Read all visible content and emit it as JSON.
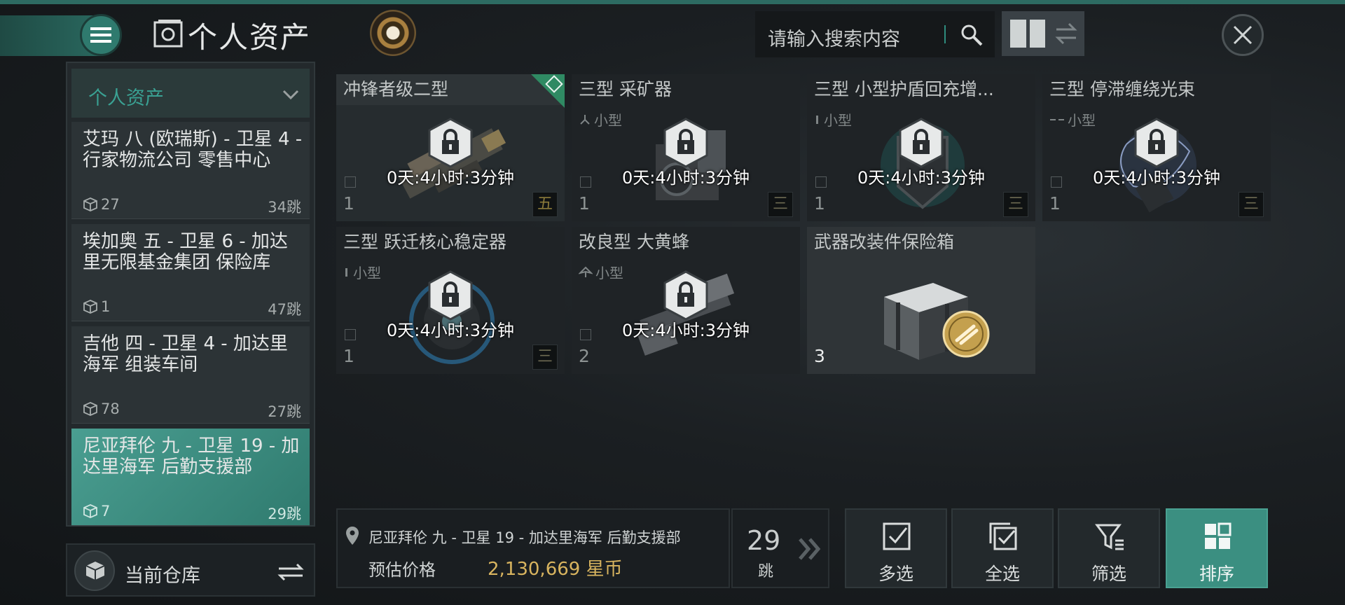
{
  "header": {
    "title": "个人资产",
    "search_placeholder": "请输入搜索内容"
  },
  "sidebar": {
    "dropdown_label": "个人资产",
    "locations": [
      {
        "name": "艾玛 八 (欧瑞斯) - 卫星 4 - 行家物流公司 零售中心",
        "count": "27",
        "jumps": "34跳"
      },
      {
        "name": "埃加奥 五 - 卫星 6 - 加达里无限基金集团 保险库",
        "count": "1",
        "jumps": "47跳"
      },
      {
        "name": "吉他 四 - 卫星 4 - 加达里海军 组装车间",
        "count": "78",
        "jumps": "27跳"
      },
      {
        "name": "尼亚拜伦 九 - 卫星 19 - 加达里海军 后勤支援部",
        "count": "7",
        "jumps": "29跳"
      }
    ],
    "warehouse_label": "当前仓库"
  },
  "items": [
    {
      "title": "冲锋者级二型",
      "subtype": "",
      "timer": "0天:4小时:3分钟",
      "qty": "1",
      "tech": "五",
      "locked": true
    },
    {
      "title": "三型 采矿器",
      "subtype": "小型",
      "timer": "0天:4小时:3分钟",
      "qty": "1",
      "tech": "三",
      "locked": true
    },
    {
      "title": "三型 小型护盾回充增...",
      "subtype": "小型",
      "timer": "0天:4小时:3分钟",
      "qty": "1",
      "tech": "三",
      "locked": true
    },
    {
      "title": "三型 停滞缠绕光束",
      "subtype": "小型",
      "timer": "0天:4小时:3分钟",
      "qty": "1",
      "tech": "三",
      "locked": true
    },
    {
      "title": "三型 跃迁核心稳定器",
      "subtype": "小型",
      "timer": "0天:4小时:3分钟",
      "qty": "1",
      "tech": "三",
      "locked": true
    },
    {
      "title": "改良型 大黄蜂",
      "subtype": "小型",
      "timer": "0天:4小时:3分钟",
      "qty": "2",
      "tech": "",
      "locked": true
    },
    {
      "title": "武器改装件保险箱",
      "subtype": "",
      "timer": "",
      "qty": "3",
      "tech": "",
      "locked": false
    }
  ],
  "bottom": {
    "location": "尼亚拜伦 九 - 卫星 19 - 加达里海军 后勤支援部",
    "price_label": "预估价格",
    "price": "2,130,669 星币",
    "jumps_num": "29",
    "jumps_unit": "跳",
    "actions": [
      "多选",
      "全选",
      "筛选",
      "排序"
    ]
  },
  "colors": {
    "accent": "#2f7a6e",
    "price": "#d8b45f",
    "active_bg": "#4a9e91"
  }
}
